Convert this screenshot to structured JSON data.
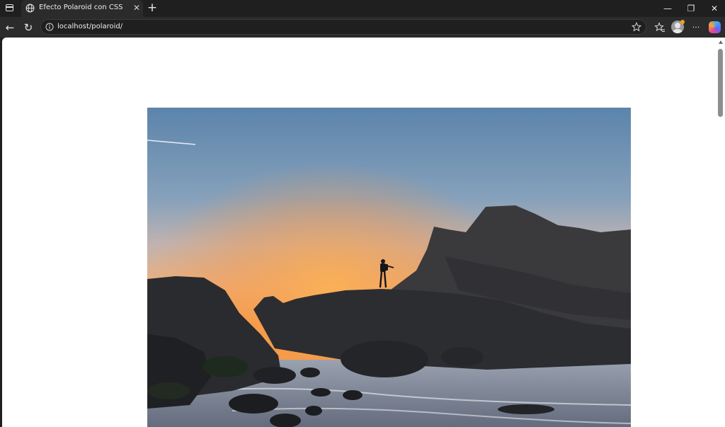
{
  "browser": {
    "tab": {
      "title": "Efecto Polaroid con CSS",
      "close_glyph": "✕",
      "favicon": "globe-icon"
    },
    "new_tab_glyph": "+",
    "window_controls": {
      "minimize": "—",
      "restore": "❐",
      "close": "✕"
    },
    "nav": {
      "back": "←",
      "reload": "↻",
      "more": "···"
    },
    "address_bar": {
      "url": "localhost/polaroid/",
      "left_icon": "info-icon",
      "right_icon": "star-icon"
    },
    "toolbar_icons": [
      "favorites-icon",
      "profile-avatar",
      "more-icon",
      "copilot-icon"
    ]
  },
  "page": {
    "photo": {
      "subject": "silhouette-on-rocks-at-sunset",
      "colors": {
        "sky_top": "#5f87ad",
        "sky_glow": "#f6a04a",
        "rocks": "#2b2c2f",
        "water": "#8c96a6"
      }
    }
  }
}
